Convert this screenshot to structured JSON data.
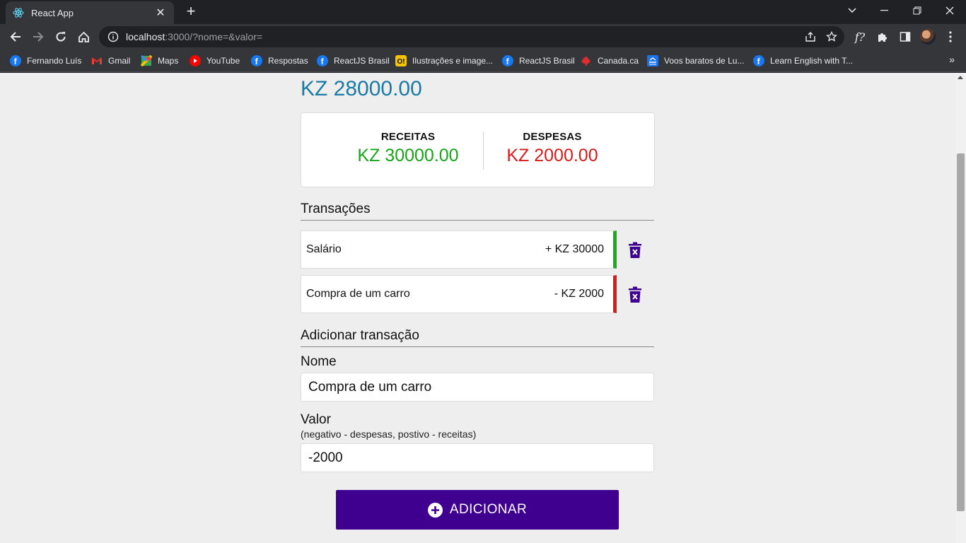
{
  "browser": {
    "tab_title": "React App",
    "url_host": "localhost",
    "url_rest": ":3000/?nome=&valor=",
    "bookmarks": [
      {
        "label": "Fernando Luís",
        "icon": "facebook-icon"
      },
      {
        "label": "Gmail",
        "icon": "gmail-icon"
      },
      {
        "label": "Maps",
        "icon": "maps-icon"
      },
      {
        "label": "YouTube",
        "icon": "youtube-icon"
      },
      {
        "label": "Respostas",
        "icon": "facebook-icon"
      },
      {
        "label": "ReactJS Brasil",
        "icon": "facebook-icon"
      },
      {
        "label": "Ilustrações e image...",
        "icon": "ouch-icon"
      },
      {
        "label": "ReactJS Brasil",
        "icon": "facebook-icon"
      },
      {
        "label": "Canada.ca",
        "icon": "maple-leaf-icon"
      },
      {
        "label": "Voos baratos de Lu...",
        "icon": "flights-icon"
      },
      {
        "label": "Learn English with T...",
        "icon": "facebook-icon"
      }
    ]
  },
  "app": {
    "balance": "KZ 28000.00",
    "summary": {
      "income_label": "RECEITAS",
      "income_value": "KZ 30000.00",
      "expense_label": "DESPESAS",
      "expense_value": "KZ 2000.00"
    },
    "transactions_title": "Transações",
    "transactions": [
      {
        "name": "Salário",
        "amount": "+ KZ 30000",
        "type": "income"
      },
      {
        "name": "Compra de um carro",
        "amount": "- KZ 2000",
        "type": "expense"
      }
    ],
    "add_title": "Adicionar transação",
    "form": {
      "name_label": "Nome",
      "name_value": "Compra de um carro",
      "value_label": "Valor",
      "value_hint": "(negativo - despesas, postivo - receitas)",
      "value_value": "-2000",
      "submit_label": "ADICIONAR"
    }
  },
  "colors": {
    "balance": "#1b7aa6",
    "income": "#16a616",
    "expense": "#d81b1b",
    "button": "#3f0090",
    "delete_icon": "#3f0090"
  }
}
